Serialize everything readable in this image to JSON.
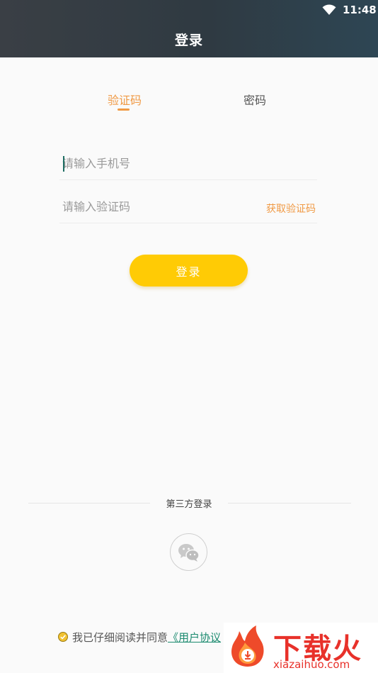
{
  "status_bar": {
    "time": "11:48",
    "icons": [
      "wifi-icon"
    ]
  },
  "header": {
    "title": "登录"
  },
  "tabs": [
    {
      "label": "验证码",
      "active": true
    },
    {
      "label": "密码",
      "active": false
    }
  ],
  "form": {
    "phone_placeholder": "请输入手机号",
    "code_placeholder": "请输入验证码",
    "get_code_label": "获取验证码",
    "login_label": "登录"
  },
  "third_party": {
    "label": "第三方登录",
    "icons": [
      "wechat-icon"
    ]
  },
  "agreement": {
    "text": "我已仔细阅读并同意",
    "link_text": "《用户协议"
  },
  "watermark": {
    "title": "下载火",
    "url": "xiazaihuo.com"
  },
  "colors": {
    "accent": "#f09a45",
    "button": "#ffcb05",
    "link": "#1b8a6f",
    "header": "#343c43"
  }
}
